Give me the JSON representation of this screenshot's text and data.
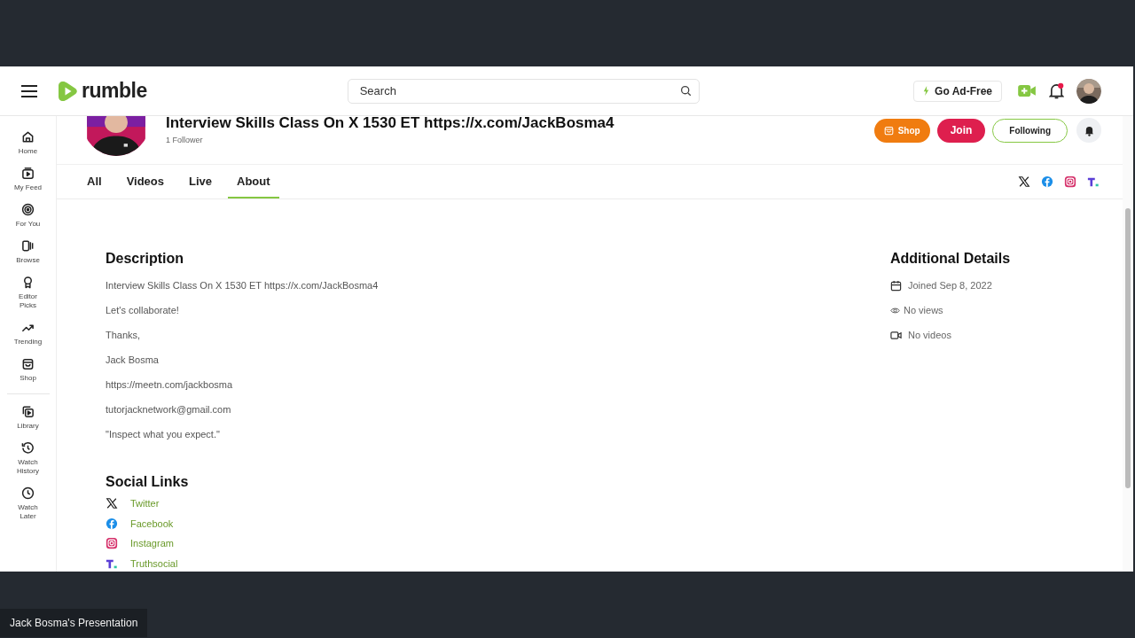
{
  "header": {
    "logo": "rumble",
    "search": {
      "placeholder": "Search"
    },
    "ad_free": "Go Ad-Free",
    "notifications": {
      "unread": true
    }
  },
  "sidebar": {
    "sections": [
      [
        {
          "label": "Home"
        },
        {
          "label": "My Feed"
        },
        {
          "label": "For You"
        },
        {
          "label": "Browse"
        },
        {
          "label": "Editor Picks"
        },
        {
          "label": "Trending"
        },
        {
          "label": "Shop"
        }
      ],
      [
        {
          "label": "Library"
        },
        {
          "label": "Watch History"
        },
        {
          "label": "Watch Later"
        }
      ]
    ]
  },
  "channel": {
    "title": "Interview Skills Class On X 1530 ET https://x.com/JackBosma4",
    "followers": "1 Follower",
    "buttons": [
      {
        "label": "Shop",
        "kind": "shop"
      },
      {
        "label": "Join",
        "kind": "join"
      },
      {
        "label": "Following",
        "kind": "following"
      }
    ],
    "social_icons": [
      {
        "kind": "x"
      },
      {
        "kind": "facebook"
      },
      {
        "kind": "instagram"
      },
      {
        "kind": "truth"
      }
    ]
  },
  "tabs": [
    {
      "label": "All",
      "selected": false
    },
    {
      "label": "Videos",
      "selected": false
    },
    {
      "label": "Live",
      "selected": false
    },
    {
      "label": "About",
      "selected": true
    }
  ],
  "description": {
    "title": "Description",
    "lines": [
      "Interview Skills Class On X 1530 ET https://x.com/JackBosma4",
      "Let's collaborate!",
      "Thanks,",
      "Jack Bosma",
      "https://meetn.com/jackbosma",
      "tutorjacknetwork@gmail.com",
      "\"Inspect what you expect.\""
    ]
  },
  "social_links": {
    "title": "Social Links",
    "items": [
      {
        "label": "Twitter",
        "kind": "x"
      },
      {
        "label": "Facebook",
        "kind": "facebook"
      },
      {
        "label": "Instagram",
        "kind": "instagram"
      },
      {
        "label": "Truthsocial",
        "kind": "truth"
      }
    ]
  },
  "details": {
    "title": "Additional Details",
    "items": [
      {
        "label": "Joined Sep 8, 2022",
        "kind": "calendar"
      },
      {
        "label": "No views",
        "kind": "views"
      },
      {
        "label": "No videos",
        "kind": "videos"
      }
    ]
  },
  "presenter_label": "Jack Bosma's Presentation"
}
